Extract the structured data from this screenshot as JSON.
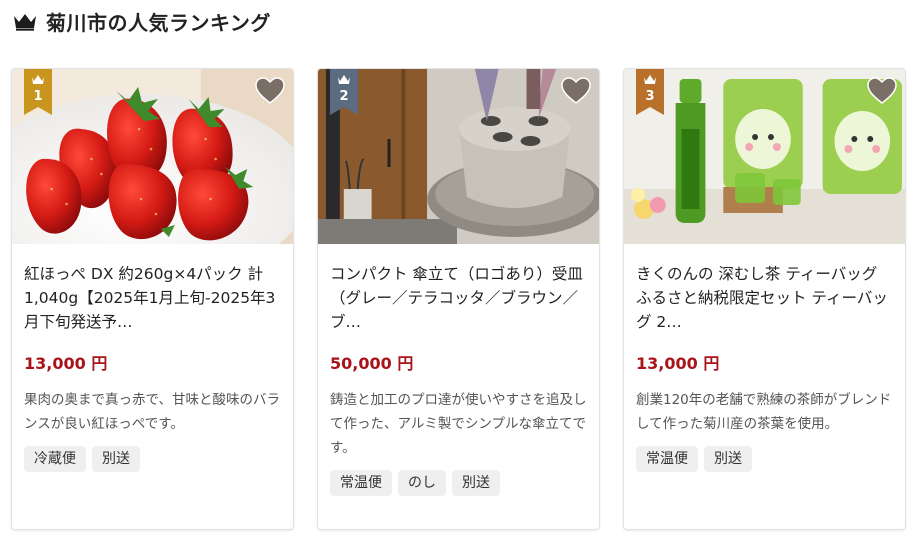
{
  "page": {
    "title": "菊川市の人気ランキング",
    "crown_icon": "crown-icon"
  },
  "colors": {
    "price": "#a8141a",
    "rank_gold": "#c8961e",
    "rank_silver": "#5b6b80",
    "rank_bronze": "#b8702b",
    "heart": "#7a6f66"
  },
  "products": [
    {
      "rank": "1",
      "name": "紅ほっぺ DX 約260g×4パック 計1,040g【2025年1月上旬-2025年3月下旬発送予…",
      "price": "13,000 円",
      "description": "果肉の奥まで真っ赤で、甘味と酸味のバランスが良い紅ほっぺです。",
      "tags": [
        "冷蔵便",
        "別送"
      ],
      "image": "strawberries-photo"
    },
    {
      "rank": "2",
      "name": "コンパクト 傘立て（ロゴあり）受皿（グレー／テラコッタ／ブラウン／ブ…",
      "price": "50,000 円",
      "description": "鋳造と加工のプロ達が使いやすさを追及して作った、アルミ製でシンプルな傘立てです。",
      "tags": [
        "常温便",
        "のし",
        "別送"
      ],
      "image": "umbrella-stand-photo"
    },
    {
      "rank": "3",
      "name": "きくのんの 深むし茶 ティーバッグ ふるさと納税限定セット ティーバッグ 2…",
      "price": "13,000 円",
      "description": "創業120年の老舗で熟練の茶師がブレンドして作った菊川産の茶葉を使用。",
      "tags": [
        "常温便",
        "別送"
      ],
      "image": "green-tea-photo"
    }
  ]
}
